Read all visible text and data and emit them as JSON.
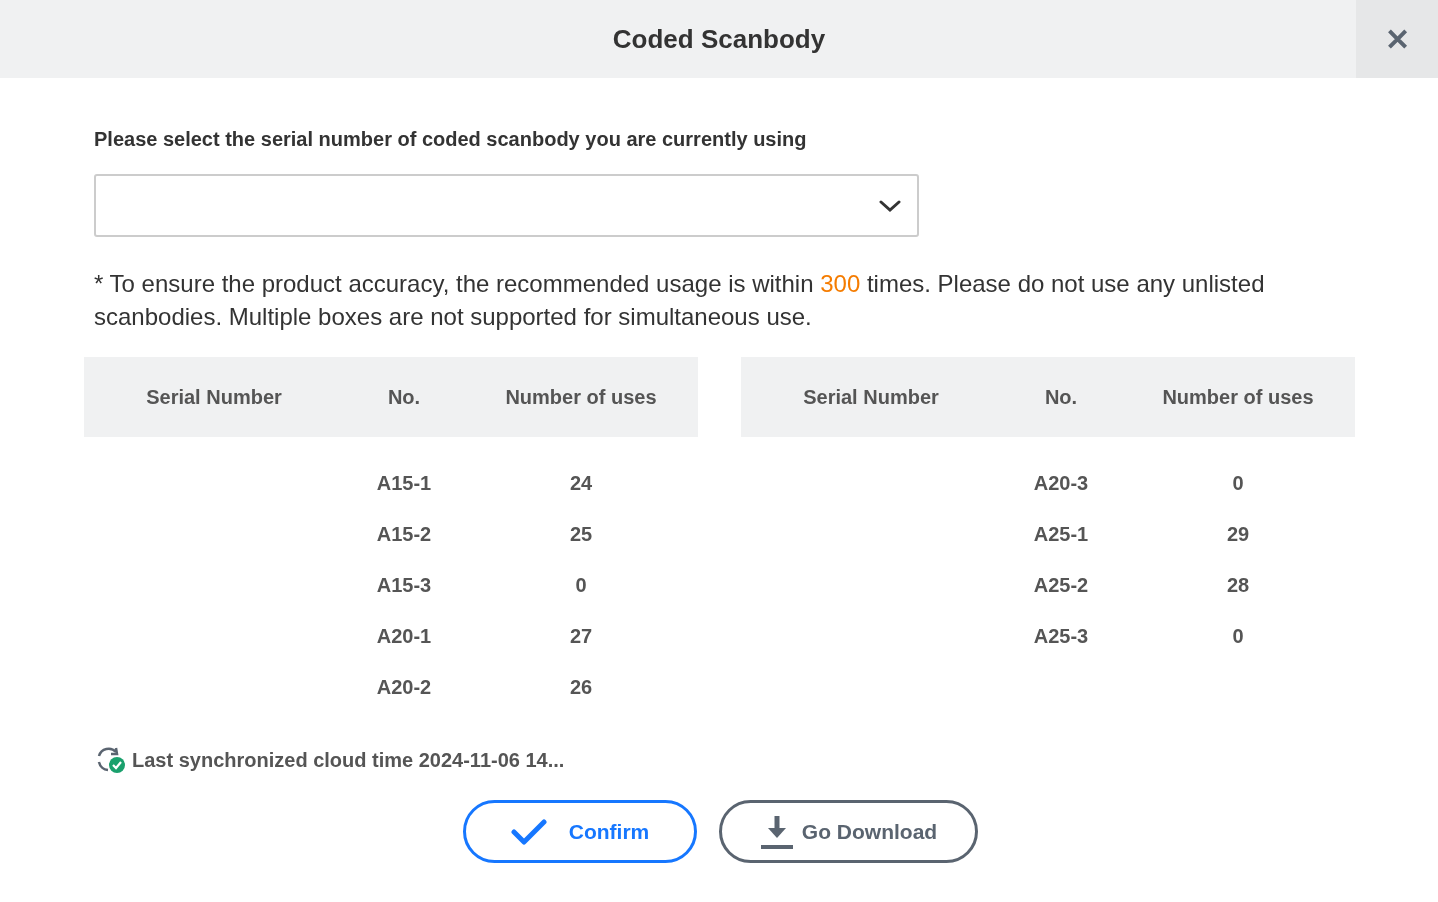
{
  "dialog": {
    "title": "Coded Scanbody",
    "close": "✕"
  },
  "select_label": "Please select the serial number of coded scanbody you are currently using",
  "notice": {
    "before": "* To ensure the product accuracy, the recommended usage is within ",
    "highlight": "300",
    "after": " times. Please do not use any unlisted scanbodies. Multiple boxes are not supported for simultaneous use."
  },
  "tables": [
    {
      "columns": [
        "Serial Number",
        "No.",
        "Number of uses"
      ],
      "rows": [
        {
          "no": "A15-1",
          "uses": "24"
        },
        {
          "no": "A15-2",
          "uses": "25"
        },
        {
          "no": "A15-3",
          "uses": "0"
        },
        {
          "no": "A20-1",
          "uses": "27"
        },
        {
          "no": "A20-2",
          "uses": "26"
        }
      ]
    },
    {
      "columns": [
        "Serial Number",
        "No.",
        "Number of uses"
      ],
      "rows": [
        {
          "no": "A20-3",
          "uses": "0"
        },
        {
          "no": "A25-1",
          "uses": "29"
        },
        {
          "no": "A25-2",
          "uses": "28"
        },
        {
          "no": "A25-3",
          "uses": "0"
        }
      ]
    }
  ],
  "sync_status": "Last synchronized cloud time 2024-11-06 14...",
  "buttons": [
    {
      "kind": "confirm",
      "label": "Confirm"
    },
    {
      "kind": "download",
      "label": "Go Download"
    }
  ]
}
